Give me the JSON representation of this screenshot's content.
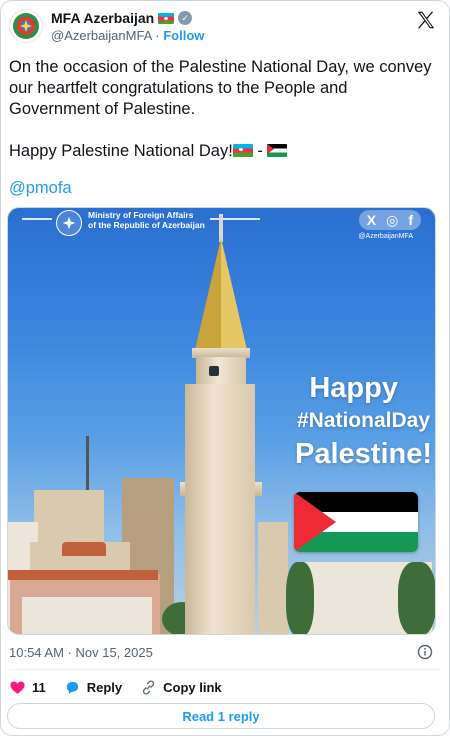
{
  "account": {
    "name": "MFA Azerbaijan",
    "handle": "@AzerbaijanMFA",
    "separator": "·",
    "follow_label": "Follow"
  },
  "icons": {
    "avatar": "mfa-emblem-icon",
    "flag_in_name": "azerbaijan-flag-icon",
    "verified": "verified-badge-icon",
    "platform": "x-logo-icon",
    "info": "info-icon",
    "like": "heart-icon",
    "reply": "reply-bubble-icon",
    "copy": "link-icon"
  },
  "post": {
    "paragraph1": "On the occasion of the Palestine National Day, we convey our heartfelt congratulations to the People and Government of Palestine.",
    "paragraph2": "Happy Palestine National Day!",
    "flag_separator": "-",
    "mention": "@pmofa"
  },
  "media": {
    "ministry_line1": "Ministry of Foreign Affairs",
    "ministry_line2": "of the Republic of Azerbaijan",
    "social_handle": "@AzerbaijanMFA",
    "social_glyphs": [
      "X",
      "◎",
      "f"
    ],
    "headline1": "Happy",
    "headline2": "#NationalDay",
    "headline3": "Palestine!"
  },
  "footer": {
    "timestamp": "10:54 AM · Nov 15, 2025",
    "likes": "11",
    "reply_label": "Reply",
    "copy_label": "Copy link",
    "read_replies_label": "Read 1 reply"
  },
  "colors": {
    "accent": "#1d9bf0",
    "like": "#f91880",
    "text": "#0f1419",
    "muted": "#536471"
  }
}
